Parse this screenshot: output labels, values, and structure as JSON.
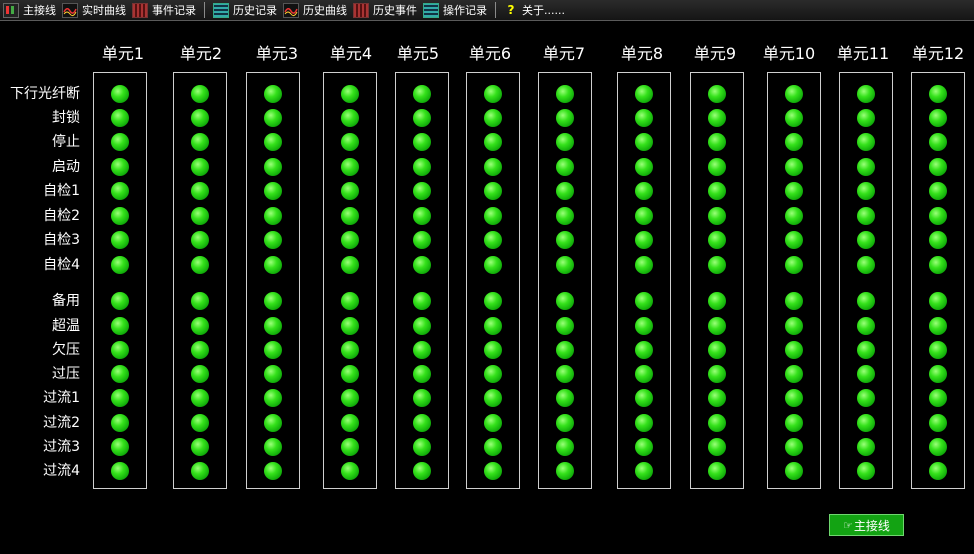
{
  "toolbar": {
    "items": [
      {
        "label": "主接线",
        "icon": "main-wiring-icon"
      },
      {
        "label": "实时曲线",
        "icon": "realtime-curve-icon"
      },
      {
        "label": "事件记录",
        "icon": "event-record-icon"
      },
      {
        "label": "历史记录",
        "icon": "history-record-icon"
      },
      {
        "label": "历史曲线",
        "icon": "history-curve-icon"
      },
      {
        "label": "历史事件",
        "icon": "history-event-icon"
      },
      {
        "label": "操作记录",
        "icon": "operation-record-icon"
      },
      {
        "label": "关于......",
        "icon": "help-icon"
      }
    ]
  },
  "units": [
    "单元1",
    "单元2",
    "单元3",
    "单元4",
    "单元5",
    "单元6",
    "单元7",
    "单元8",
    "单元9",
    "单元10",
    "单元11",
    "单元12"
  ],
  "signals": [
    "下行光纤断",
    "封锁",
    "停止",
    "启动",
    "自检1",
    "自检2",
    "自检3",
    "自检4",
    "备用",
    "超温",
    "欠压",
    "过压",
    "过流1",
    "过流2",
    "过流3",
    "过流4"
  ],
  "indicator_state": "on",
  "indicator_color": "#22dd11",
  "footer": {
    "button_label": "主接线",
    "button_icon": "pointing-hand-icon"
  }
}
